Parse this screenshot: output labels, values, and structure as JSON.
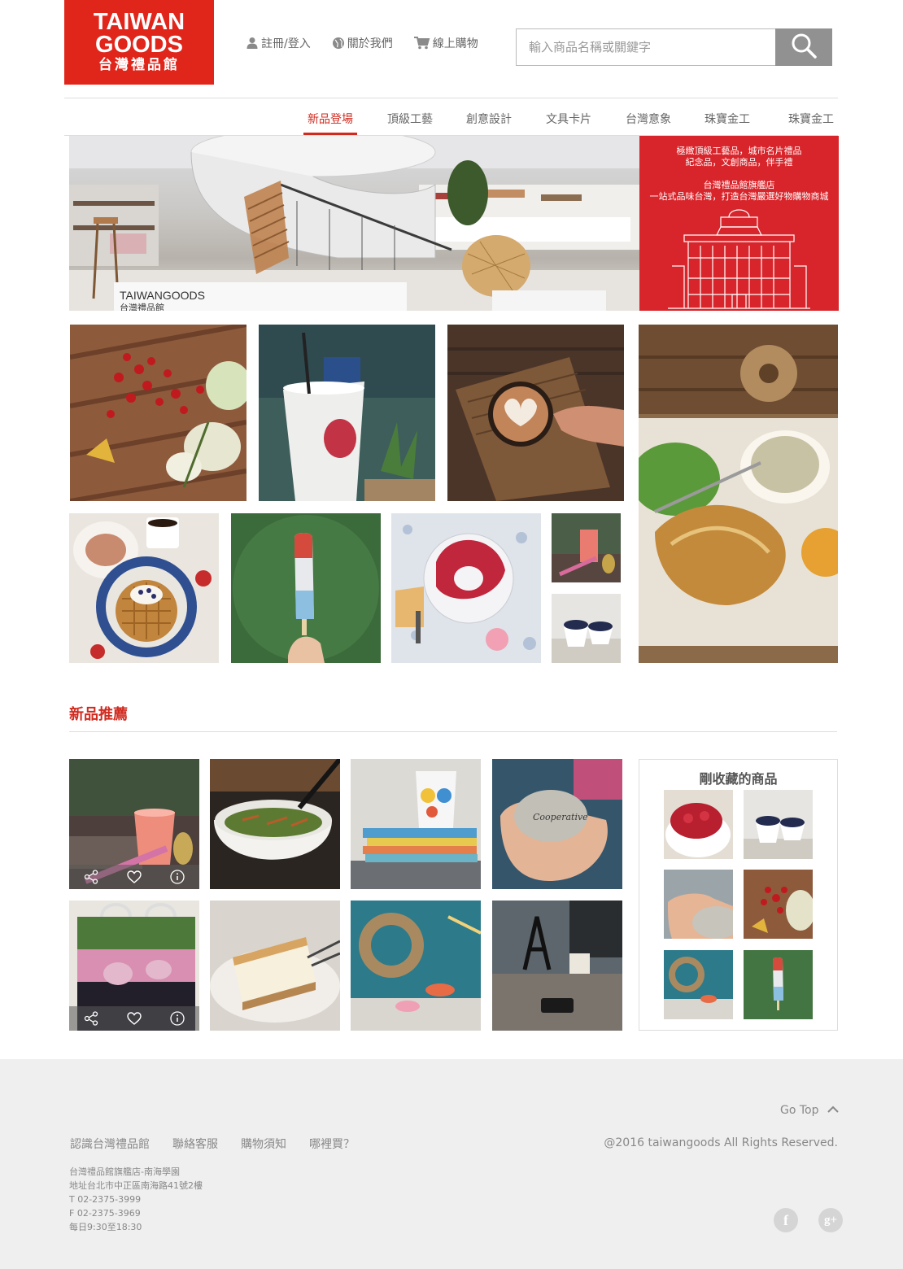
{
  "brand": {
    "line1": "TAIWAN",
    "line2": "GOODS",
    "line3": "台灣禮品館",
    "color": "#e0251b"
  },
  "topnav": [
    {
      "label": "註冊/登入",
      "icon": "user-icon"
    },
    {
      "label": "關於我們",
      "icon": "globe-icon"
    },
    {
      "label": "線上購物",
      "icon": "cart-icon"
    }
  ],
  "search": {
    "placeholder": "輸入商品名稱或關鍵字",
    "value": "",
    "icon": "search-icon"
  },
  "categories": [
    "新品登場",
    "頂級工藝",
    "創意設計",
    "文具卡片",
    "台灣意象",
    "珠寶金工",
    "珠寶金工"
  ],
  "active_category": "新品登場",
  "banner": {
    "sign": "TAIWANGOODS",
    "sign_sub": "台灣禮品館",
    "line1": "極緻頂級工藝品，城市名片禮品",
    "line2": "紀念品，文創商品，伴手禮",
    "line3": "台灣禮品館旗艦店",
    "line4": "一站式品味台灣，打造台灣嚴選好物購物商城",
    "accent": "#d8252b"
  },
  "new_section": {
    "title": "新品推薦"
  },
  "product_actions": {
    "share_icon": "share-icon",
    "like_icon": "heart-icon",
    "info_icon": "info-icon"
  },
  "favorites": {
    "title": "剛收藏的商品"
  },
  "footer": {
    "gotop": "Go Top",
    "links": [
      "認識台灣禮品館",
      "聯絡客服",
      "購物須知",
      "哪裡買？"
    ],
    "copyright": "@2016 taiwangoods All Rights Reserved.",
    "address_lines": [
      "台灣禮品館旗艦店-南海學園",
      "地址台北市中正區南海路41號2樓",
      "T  02-2375-3999",
      "F  02-2375-3969",
      "每日9:30至18:30"
    ],
    "social": [
      {
        "label": "f",
        "icon": "facebook-icon"
      },
      {
        "label": "g+",
        "icon": "google-plus-icon"
      }
    ]
  }
}
